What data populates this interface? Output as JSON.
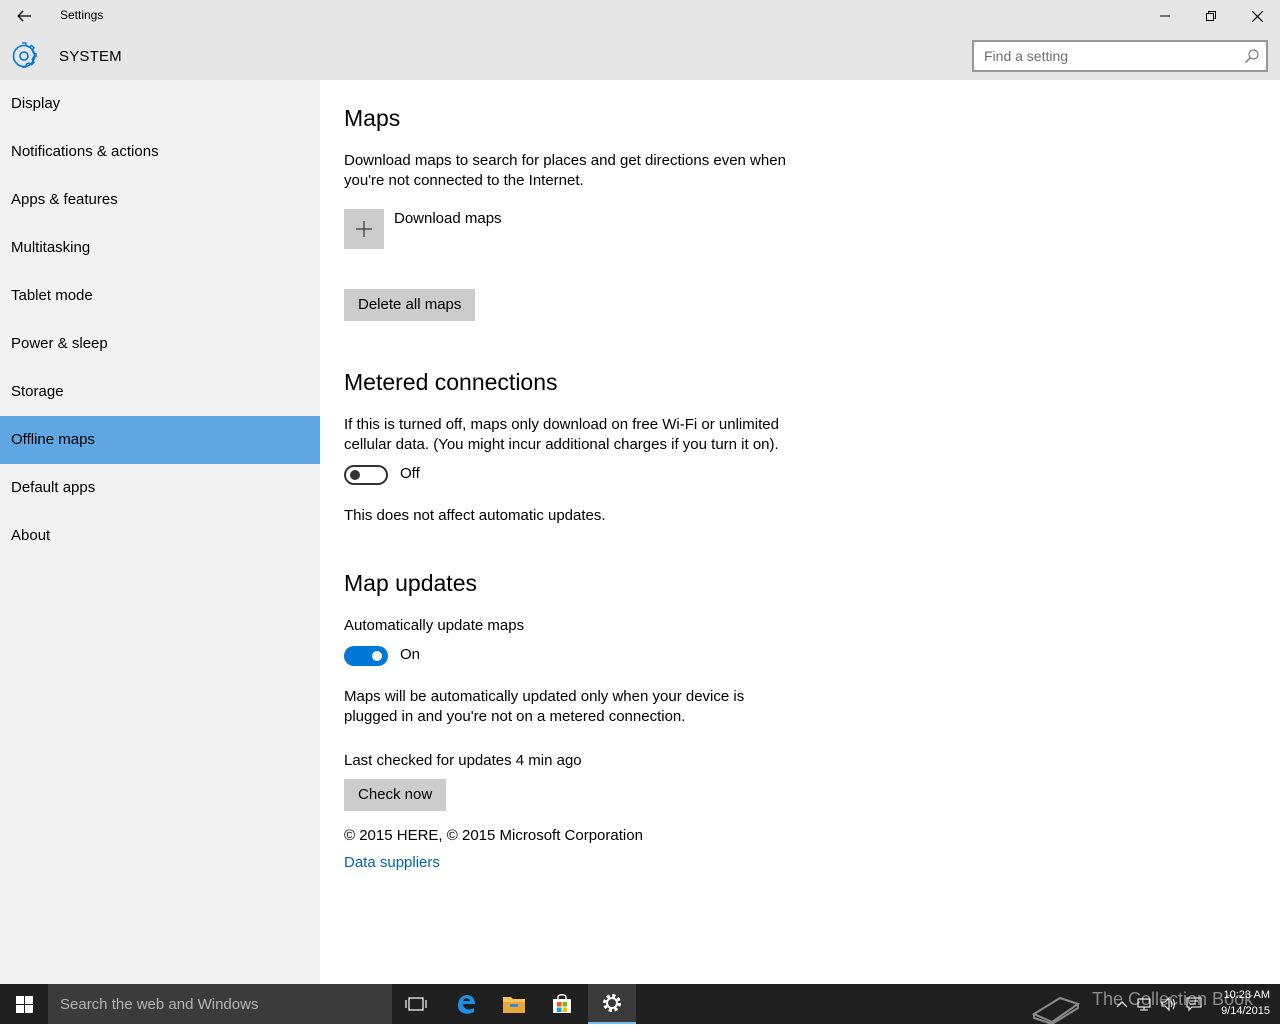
{
  "window": {
    "title": "Settings"
  },
  "header": {
    "section": "SYSTEM",
    "search_placeholder": "Find a setting"
  },
  "sidebar": {
    "items": [
      {
        "label": "Display"
      },
      {
        "label": "Notifications & actions"
      },
      {
        "label": "Apps & features"
      },
      {
        "label": "Multitasking"
      },
      {
        "label": "Tablet mode"
      },
      {
        "label": "Power & sleep"
      },
      {
        "label": "Storage"
      },
      {
        "label": "Offline maps",
        "selected": true
      },
      {
        "label": "Default apps"
      },
      {
        "label": "About"
      }
    ]
  },
  "maps": {
    "title": "Maps",
    "description": "Download maps to search for places and get directions even when you're not connected to the Internet.",
    "download_label": "Download maps",
    "delete_label": "Delete all maps"
  },
  "metered": {
    "title": "Metered connections",
    "description": "If this is turned off, maps only download on free Wi-Fi or unlimited cellular data. (You might incur additional charges if you turn it on).",
    "toggle_state": "Off",
    "note": "This does not affect automatic updates."
  },
  "updates": {
    "title": "Map updates",
    "auto_label": "Automatically update maps",
    "toggle_state": "On",
    "description": "Maps will be automatically updated only when your device is plugged in and you're not on a metered connection.",
    "last_checked": "Last checked for updates 4 min ago",
    "check_now_label": "Check now",
    "copyright": "© 2015 HERE, © 2015 Microsoft Corporation",
    "data_suppliers_link": "Data suppliers"
  },
  "taskbar": {
    "search_placeholder": "Search the web and Windows",
    "watermark": "The Collection Book",
    "time": "10:23 AM",
    "date": "9/14/2015"
  },
  "colors": {
    "accent": "#0078d7",
    "selected_nav": "#5ea7e2",
    "link": "#0063b1"
  }
}
